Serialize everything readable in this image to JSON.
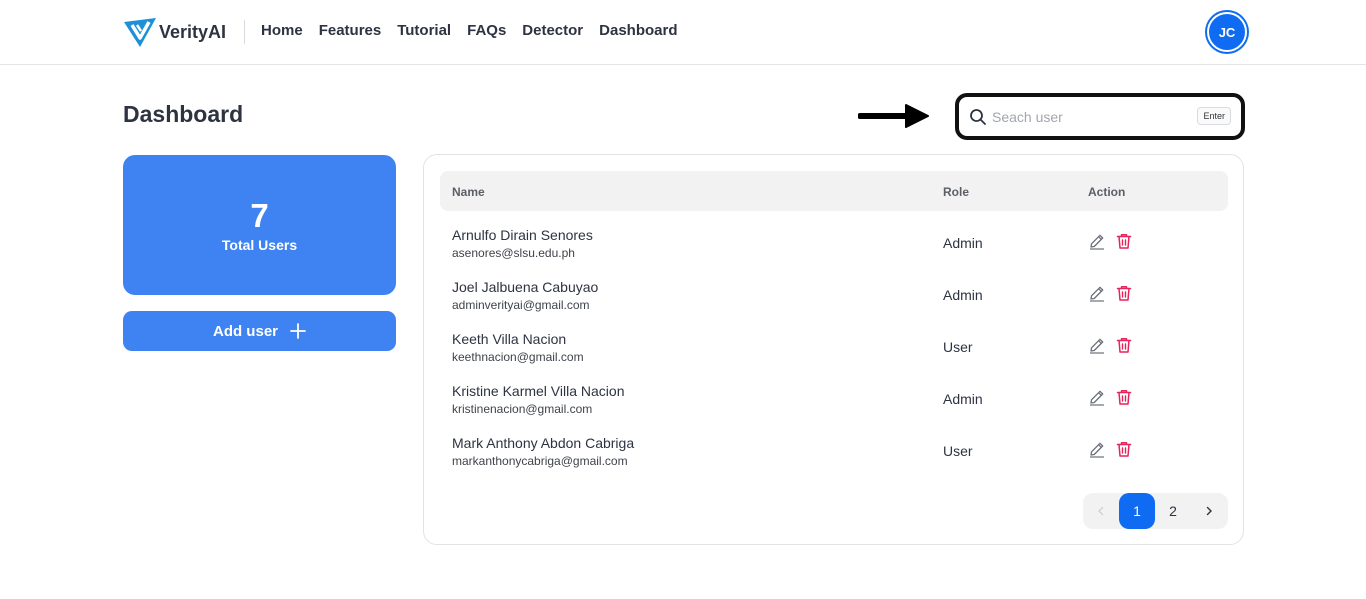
{
  "navbar": {
    "brand": "VerityAI",
    "links": [
      "Home",
      "Features",
      "Tutorial",
      "FAQs",
      "Detector",
      "Dashboard"
    ],
    "avatar_initials": "JC"
  },
  "page": {
    "title": "Dashboard"
  },
  "search": {
    "placeholder": "Seach user",
    "value": "",
    "enter_key": "Enter"
  },
  "stats": {
    "total_users_value": "7",
    "total_users_label": "Total Users"
  },
  "actions": {
    "add_user_label": "Add user"
  },
  "table": {
    "columns": [
      "Name",
      "Role",
      "Action"
    ],
    "rows": [
      {
        "name": "Arnulfo Dirain Senores",
        "email": "asenores@slsu.edu.ph",
        "role": "Admin"
      },
      {
        "name": "Joel Jalbuena Cabuyao",
        "email": "adminverityai@gmail.com",
        "role": "Admin"
      },
      {
        "name": "Keeth Villa Nacion",
        "email": "keethnacion@gmail.com",
        "role": "User"
      },
      {
        "name": "Kristine Karmel Villa Nacion",
        "email": "kristinenacion@gmail.com",
        "role": "Admin"
      },
      {
        "name": "Mark Anthony Abdon Cabriga",
        "email": "markanthonycabriga@gmail.com",
        "role": "User"
      }
    ]
  },
  "pagination": {
    "pages": [
      "1",
      "2"
    ],
    "current": "1"
  },
  "icons": {
    "brand": "verityai-logo-icon",
    "search": "search-icon",
    "plus": "plus-icon",
    "edit": "pencil-icon",
    "delete": "trash-icon",
    "prev": "chevron-left-icon",
    "next": "chevron-right-icon",
    "annotation": "arrow-right-icon"
  },
  "colors": {
    "primary": "#3f83f2",
    "accent": "#0f6cf2",
    "delete": "#e5245b",
    "logo": "#1f8fd6"
  }
}
